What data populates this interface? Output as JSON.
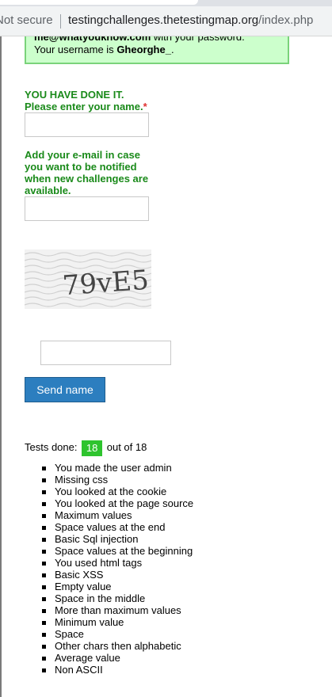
{
  "browser": {
    "security_label": "Not secure",
    "url_host": "testingchallenges.thetestingmap.org",
    "url_path": "/index.php"
  },
  "success_box": {
    "line1_prefix": "me@whatyouknow.com",
    "line1_suffix": " with your password.",
    "line2_prefix": "Your username is ",
    "username": "Gheorghe_",
    "line2_suffix": "."
  },
  "form": {
    "heading_line1": "YOU HAVE DONE IT.",
    "heading_line2": "Please enter your name.",
    "required_mark": "*",
    "name_value": "",
    "email_label": "Add your e-mail in case you want to be notified when new challenges are available.",
    "email_value": "",
    "captcha_text": "79vE5",
    "captcha_value": "",
    "submit_label": "Send name"
  },
  "tests": {
    "prefix": "Tests done:",
    "done": "18",
    "suffix": "out of 18",
    "items": [
      "You made the user admin",
      "Missing css",
      "You looked at the cookie",
      "You looked at the page source",
      "Maximum values",
      "Space values at the end",
      "Basic Sql injection",
      "Space values at the beginning",
      "You used html tags",
      "Basic XSS",
      "Empty value",
      "Space in the middle",
      "More than maximum values",
      "Minimum value",
      "Space",
      "Other chars then alphabetic",
      "Average value",
      "Non ASCII"
    ]
  },
  "colors": {
    "success_bg": "#ccffcc",
    "success_border": "#7ad37a",
    "label_green": "#1a8a1a",
    "button_blue": "#2c7ebf",
    "badge_green": "#2ec42e"
  }
}
